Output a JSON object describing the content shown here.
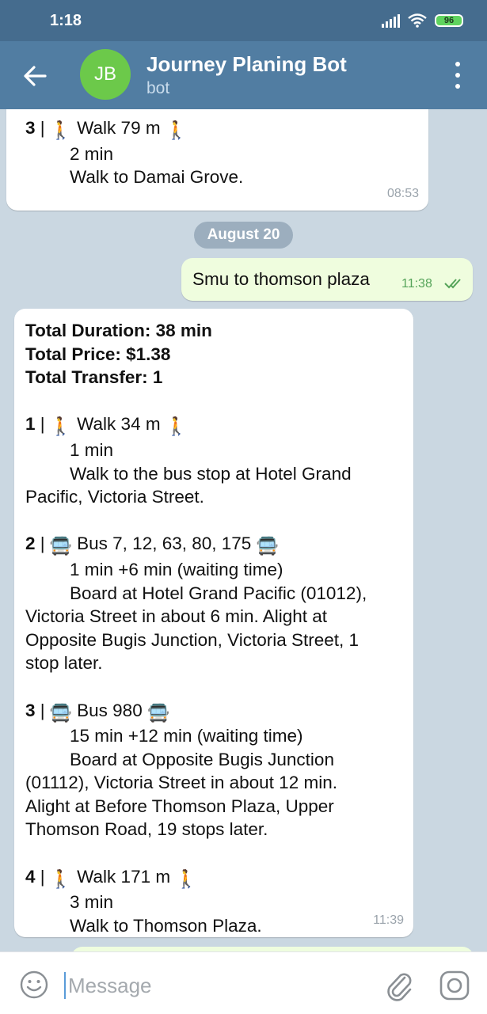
{
  "status_bar": {
    "time": "1:18",
    "battery": "96"
  },
  "header": {
    "avatar_initials": "JB",
    "title": "Journey Planing Bot",
    "subtitle": "bot"
  },
  "chat": {
    "prev_message": {
      "step_number": "3",
      "step_text": " Walk 79 m ",
      "duration": "2 min",
      "detail": "Walk to Damai Grove.",
      "time": "08:53"
    },
    "date_separator": "August 20",
    "sent_message": {
      "text": "Smu to thomson plaza",
      "time": "11:38"
    },
    "bot_reply": {
      "time": "11:39",
      "summary": {
        "total_duration": "Total Duration: 38 min",
        "total_price": "Total Price: $1.38",
        "total_transfer": "Total Transfer: 1"
      },
      "steps": [
        {
          "number": "1",
          "icon": "walk-icon",
          "title": " Walk 34 m ",
          "duration": "1 min",
          "detail_lines": [
            "Walk to the bus stop at Hotel Grand",
            "Pacific, Victoria Street."
          ]
        },
        {
          "number": "2",
          "icon": "bus-icon",
          "title": " Bus 7, 12, 63, 80, 175 ",
          "duration": "1 min +6 min (waiting time)",
          "detail_lines": [
            "Board at Hotel Grand Pacific (01012),",
            "Victoria Street in about 6 min. Alight at",
            "Opposite Bugis Junction, Victoria Street, 1",
            "stop later."
          ]
        },
        {
          "number": "3",
          "icon": "bus-icon",
          "title": " Bus 980 ",
          "duration": "15 min +12 min (waiting time)",
          "detail_lines": [
            "Board at Opposite Bugis Junction",
            "(01112), Victoria Street in about 12 min.",
            "Alight at Before Thomson Plaza, Upper",
            "Thomson Road, 19 stops later."
          ]
        },
        {
          "number": "4",
          "icon": "walk-icon",
          "title": " Walk 171 m ",
          "duration": "3 min",
          "detail_lines": [
            "Walk to Thomson Plaza."
          ]
        }
      ]
    }
  },
  "composer": {
    "placeholder": "Message"
  },
  "colors": {
    "header": "#517da2",
    "status_bar": "#456c8e",
    "chat_bg": "#cad7e1",
    "outgoing_bubble": "#effdde",
    "avatar": "#6cc94a"
  }
}
